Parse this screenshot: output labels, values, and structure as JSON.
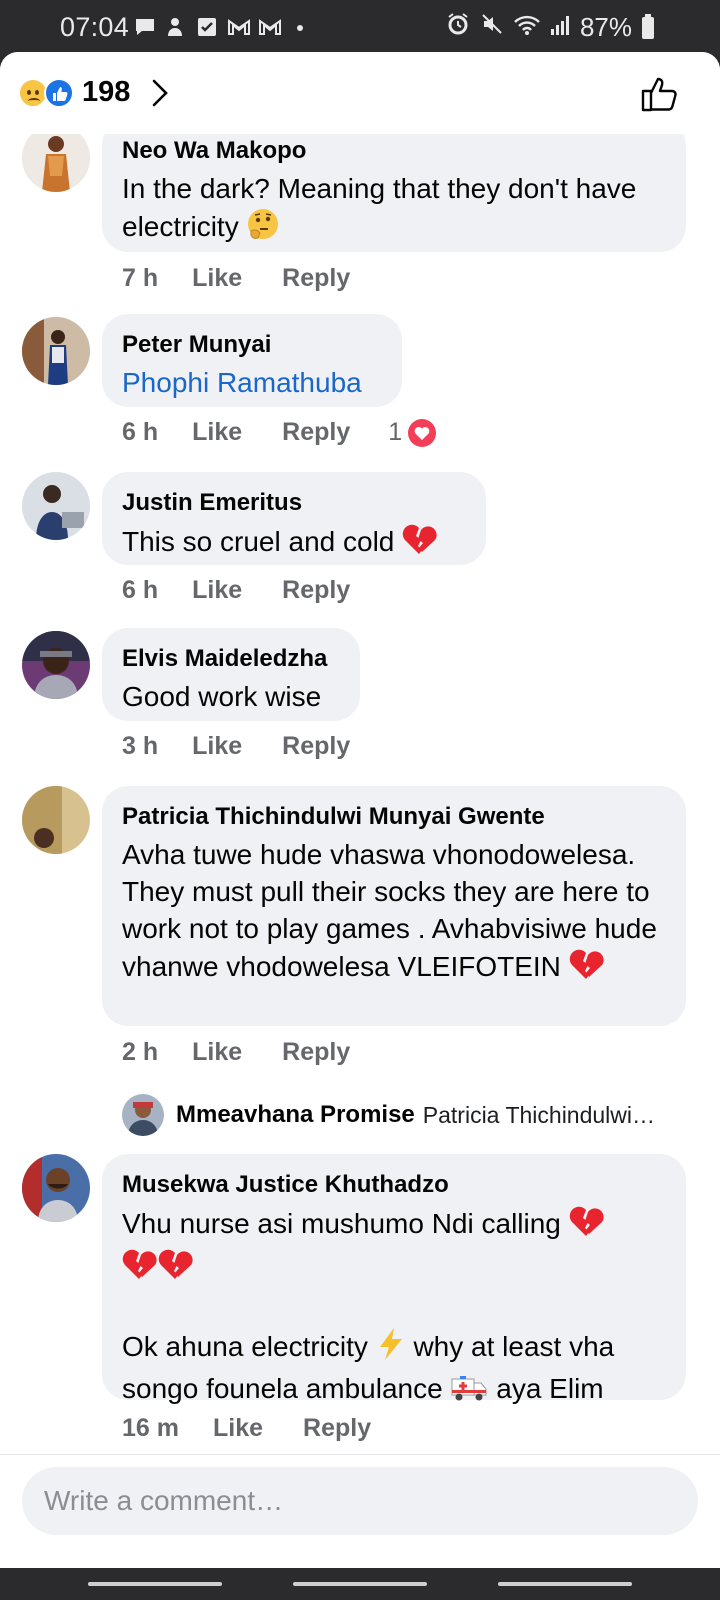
{
  "status_bar": {
    "time": "07:04",
    "battery": "87%",
    "left_icons": [
      "message-icon",
      "person-alert-icon",
      "checkbox-icon",
      "gmail-icon",
      "gmail-icon",
      "dot-icon"
    ],
    "right_icons": [
      "alarm-icon",
      "mute-icon",
      "wifi-icon",
      "signal-icon",
      "battery-icon"
    ]
  },
  "header": {
    "reaction_icons": [
      "sad-reaction-icon",
      "like-reaction-icon"
    ],
    "reaction_count": "198"
  },
  "colors": {
    "like_blue": "#1b74e4",
    "tag_blue": "#1b66c9",
    "love_red": "#f33e58",
    "bubble_gray": "#eff1f4",
    "meta_gray": "#65676b"
  },
  "comments": [
    {
      "name": "Neo Wa Makopo",
      "text": "In the dark? Meaning that they don't have electricity",
      "emoji": "thinking-face-icon",
      "time": "7 h",
      "like": "Like",
      "reply": "Reply"
    },
    {
      "name": "Peter Munyai",
      "text": "Phophi Ramathuba",
      "time": "6 h",
      "like": "Like",
      "reply": "Reply",
      "reaction_count": "1"
    },
    {
      "name": "Justin Emeritus",
      "text": "This so cruel and cold",
      "emoji": "broken-heart-icon",
      "time": "6 h",
      "like": "Like",
      "reply": "Reply"
    },
    {
      "name": "Elvis Maideledzha",
      "text": "Good work wise",
      "time": "3 h",
      "like": "Like",
      "reply": "Reply"
    },
    {
      "name": "Patricia Thichindulwi Munyai Gwente",
      "text": "Avha tuwe hude vhaswa vhonodowelesa. They must pull their socks they are here to work not to play games . Avhabvisiwe hude vhanwe vhodowelesa VLEIFOTEIN",
      "emoji": "broken-heart-icon",
      "time": "2 h",
      "like": "Like",
      "reply": "Reply",
      "reply_preview": {
        "name": "Mmeavhana Promise",
        "text": "Patricia Thichindulwi…"
      }
    },
    {
      "name": "Musekwa Justice Khuthadzo",
      "line1": "Vhu nurse asi mushumo Ndi calling",
      "line3": "Ok ahuna electricity",
      "line4": "why at least vha",
      "line5": "songo founela ambulance",
      "line5_end": "aya Elim",
      "time": "16 m",
      "like": "Like",
      "reply": "Reply"
    }
  ],
  "composer": {
    "placeholder": "Write a comment…"
  }
}
